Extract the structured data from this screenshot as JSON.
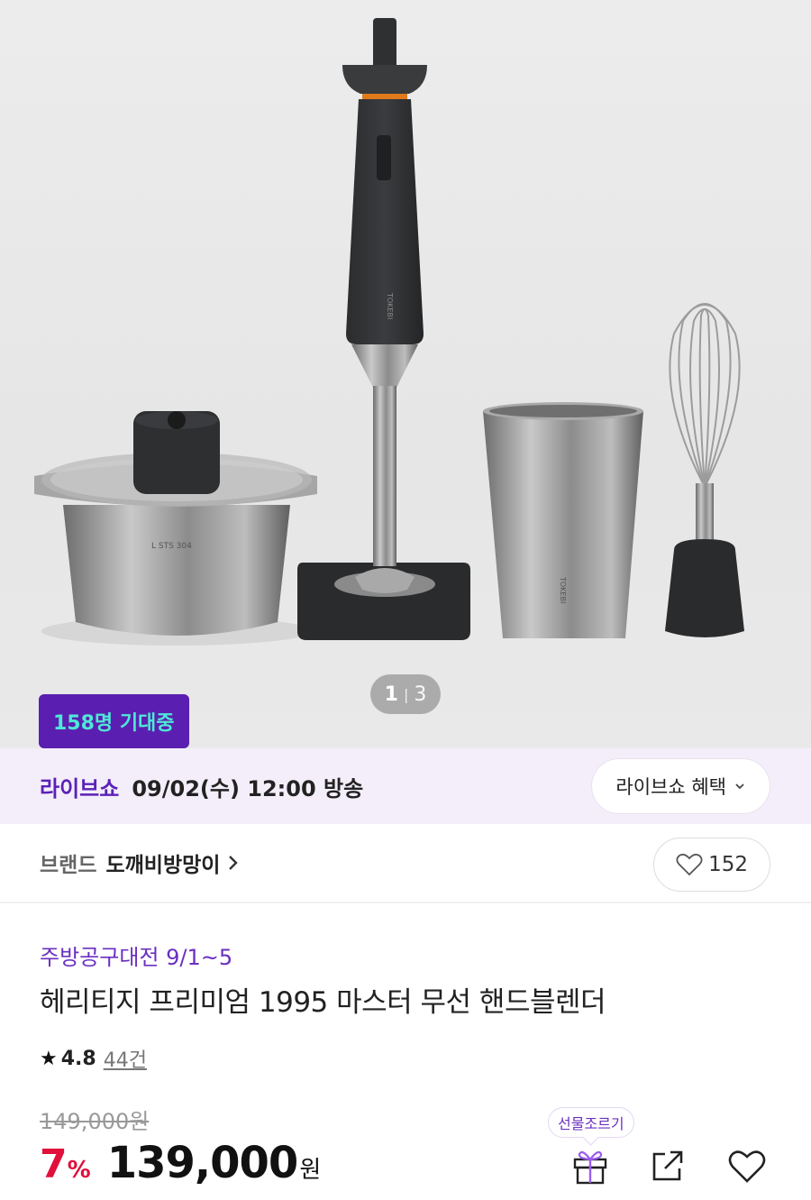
{
  "hero": {
    "pager": {
      "current": "1",
      "separator": "|",
      "total": "3"
    },
    "expect_badge": "158명 기대중",
    "product_brand_marks": [
      "TOKEBI",
      "TOKEBI",
      "L STS 304"
    ]
  },
  "live": {
    "label": "라이브쇼",
    "schedule": "09/02(수) 12:00 방송",
    "benefit_button": "라이브쇼 혜택"
  },
  "brand": {
    "label": "브랜드",
    "name": "도깨비방망이",
    "like_count": "152"
  },
  "product": {
    "promo": "주방공구대전 9/1~5",
    "title": "헤리티지 프리미엄 1995 마스터 무선 핸드블렌더",
    "rating": "4.8",
    "review_count": "44건",
    "original_price": "149,000원",
    "discount": "7",
    "discount_unit": "%",
    "price": "139,000",
    "currency": "원"
  },
  "actions": {
    "gift_tooltip": "선물조르기",
    "icons": [
      "gift-icon",
      "share-icon",
      "heart-icon"
    ]
  },
  "colors": {
    "accent_purple": "#5b21b6",
    "badge_text": "#4fe8d6",
    "discount_red": "#e0103a"
  }
}
